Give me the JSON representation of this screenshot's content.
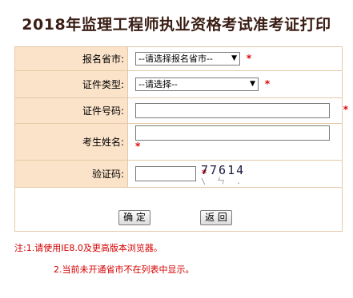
{
  "page": {
    "title": "2018年监理工程师执业资格考试准考证打印"
  },
  "form": {
    "province": {
      "label": "报名省市:",
      "value": "--请选择报名省市--"
    },
    "id_type": {
      "label": "证件类型:",
      "value": "--请选择--"
    },
    "id_number": {
      "label": "证件号码:",
      "value": ""
    },
    "name": {
      "label": "考生姓名:",
      "value": ""
    },
    "captcha": {
      "label": "验证码:",
      "value": "",
      "image_text": "77614",
      "noise": "\\ ㄣ ."
    },
    "required_mark": "*"
  },
  "buttons": {
    "confirm": "确 定",
    "back": "返 回"
  },
  "notes": {
    "prefix": "注:",
    "line1": "1.请使用IE8.0及更高版本浏览器。",
    "line2": "2.当前未开通省市不在列表中显示。"
  },
  "colors": {
    "label_bg": "#fbe3c9",
    "border": "#e5c9a8",
    "required": "#e00000",
    "title": "#3a1d14"
  }
}
